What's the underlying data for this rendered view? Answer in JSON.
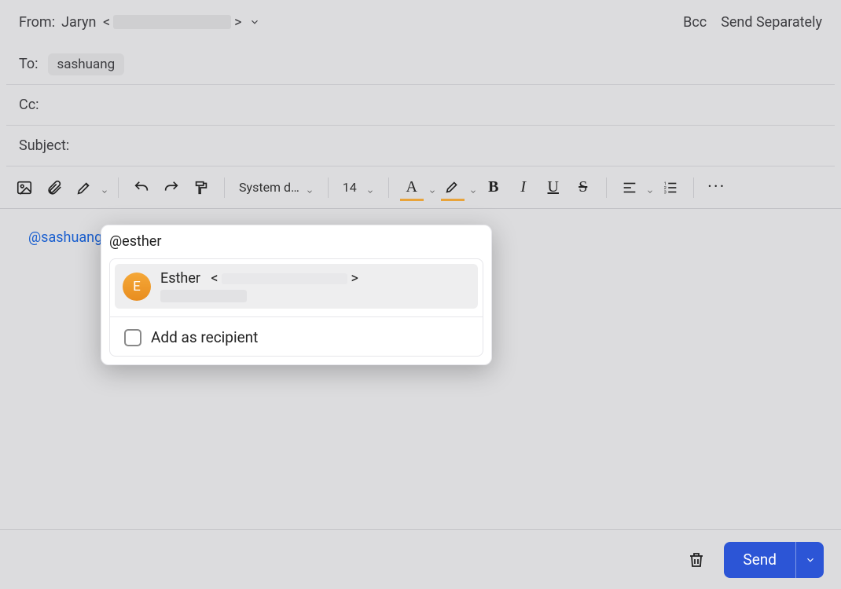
{
  "header": {
    "from_label": "From:",
    "from_name": "Jaryn",
    "to_label": "To:",
    "cc_label": "Cc:",
    "subject_label": "Subject:",
    "bcc_button": "Bcc",
    "send_separately_button": "Send Separately",
    "to_recipients": [
      {
        "name": "sashuang"
      }
    ]
  },
  "toolbar": {
    "font_family": "System d…",
    "font_size": "14"
  },
  "editor": {
    "mention_link": "@sashuang",
    "mention_typed": "@esther"
  },
  "mention_popup": {
    "typed_echo": "@esther",
    "suggestion": {
      "avatar_initial": "E",
      "name": "Esther",
      "email_open": "<",
      "email_close": ">"
    },
    "add_as_recipient_label": "Add as recipient"
  },
  "footer": {
    "send_label": "Send"
  }
}
